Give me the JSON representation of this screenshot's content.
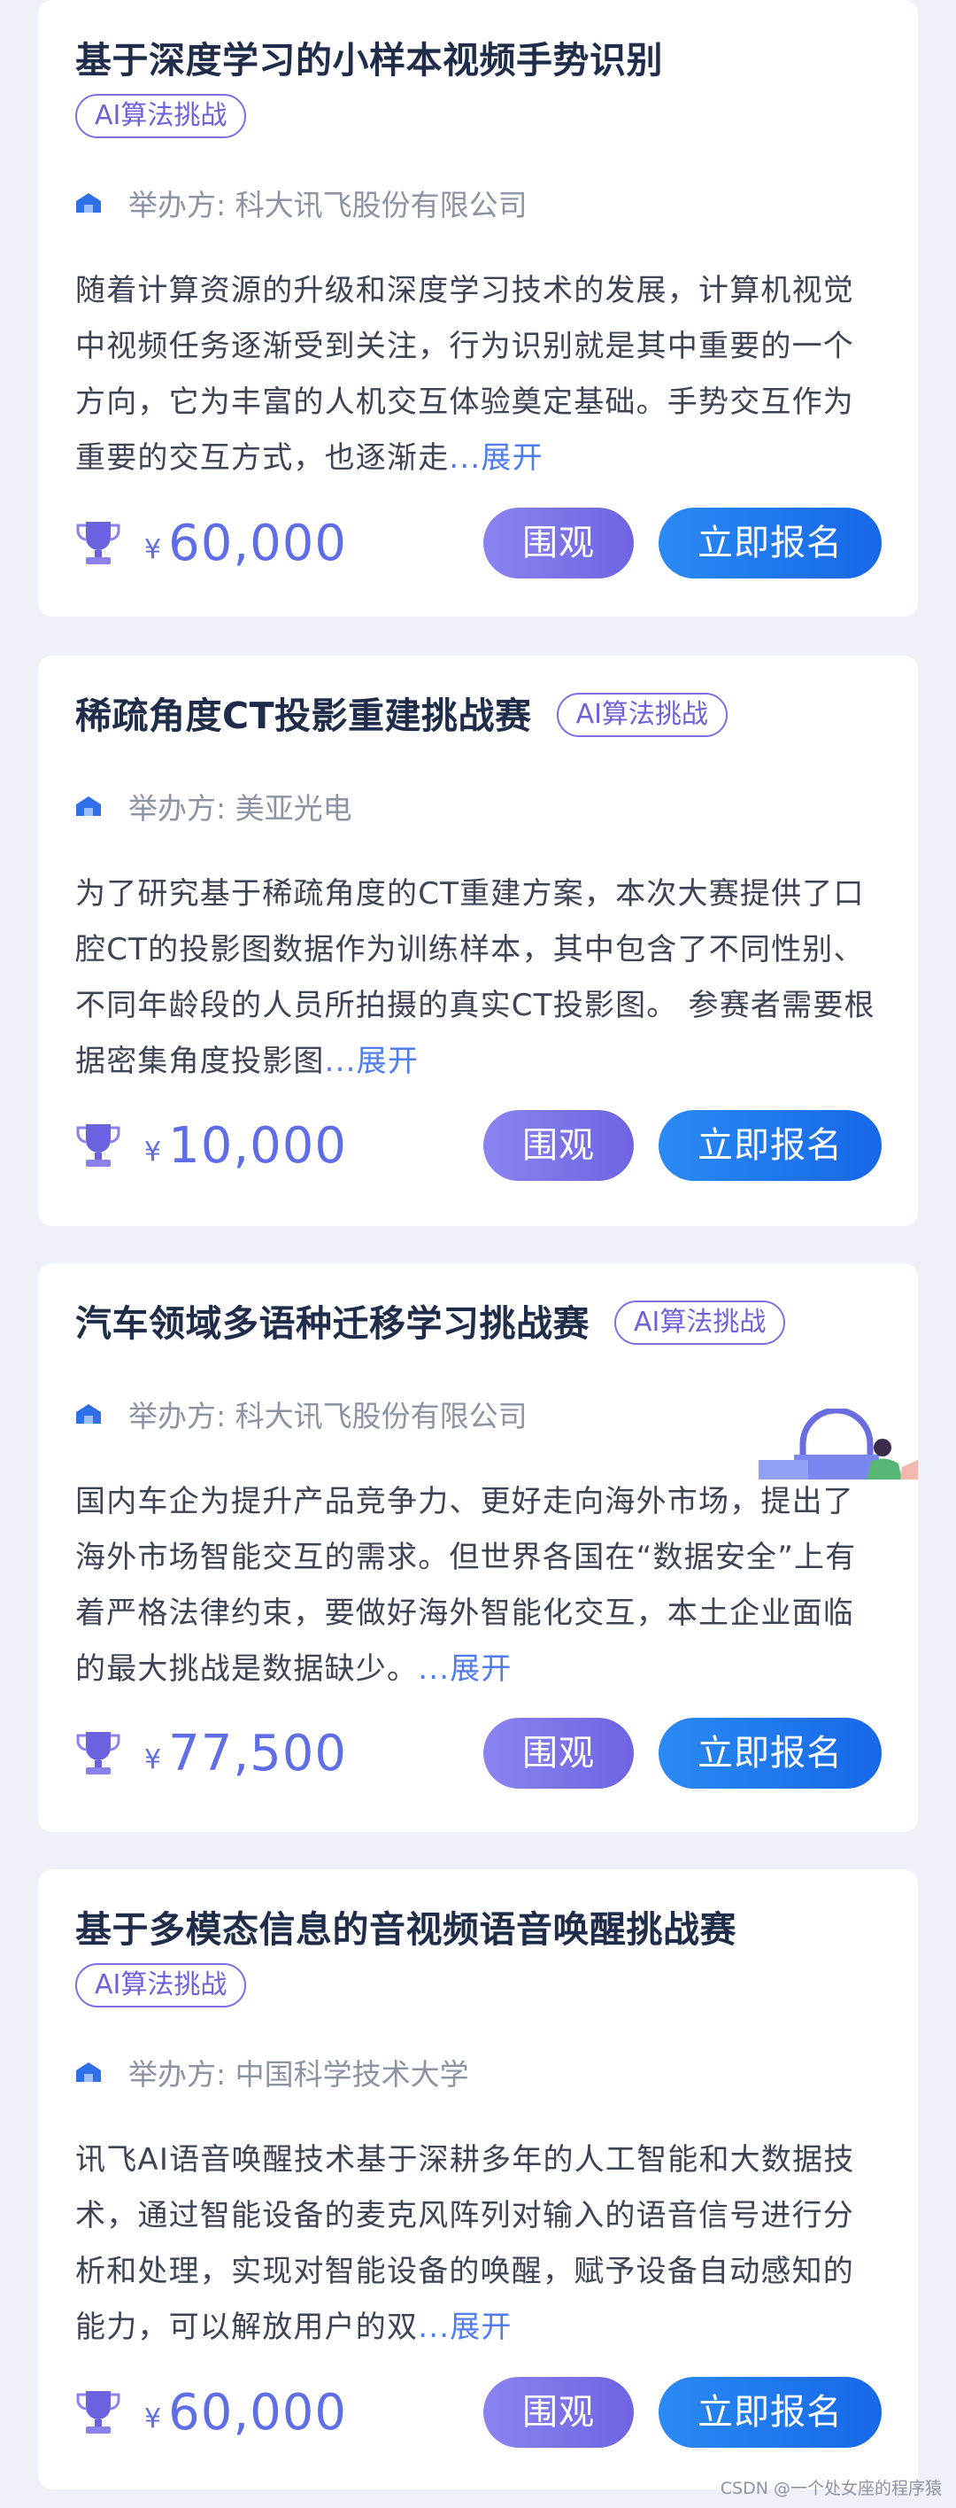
{
  "colors": {
    "background": "#eef1f7",
    "title": "#1f2c4a",
    "accent_purple": "#6e62d9",
    "prize_blue": "#5f6ee6",
    "primary_blue": "#1768e8",
    "more_link": "#4f7cf0"
  },
  "competitions": [
    {
      "title": "基于深度学习的小样本视频手势识别",
      "tag": "AI算法挑战",
      "organizer": "举办方: 科大讯飞股份有限公司",
      "description": "随着计算资源的升级和深度学习技术的发展，计算机视觉中视频任务逐渐受到关注，行为识别就是其中重要的一个方向，它为丰富的人机交互体验奠定基础。手势交互作为重要的交互方式，也逐渐走",
      "more": "...展开",
      "currency": "¥",
      "prize": "60,000",
      "watch_label": "围观",
      "signup_label": "立即报名",
      "icons": [
        "house-icon",
        "trophy-icon"
      ]
    },
    {
      "title": "稀疏角度CT投影重建挑战赛",
      "tag": "AI算法挑战",
      "organizer": "举办方: 美亚光电",
      "description": "为了研究基于稀疏角度的CT重建方案，本次大赛提供了口腔CT的投影图数据作为训练样本，其中包含了不同性别、不同年龄段的人员所拍摄的真实CT投影图。 参赛者需要根据密集角度投影图",
      "more": "...展开",
      "currency": "¥",
      "prize": "10,000",
      "watch_label": "围观",
      "signup_label": "立即报名",
      "icons": [
        "house-icon",
        "trophy-icon"
      ]
    },
    {
      "title": "汽车领域多语种迁移学习挑战赛",
      "tag": "AI算法挑战",
      "organizer": "举办方: 科大讯飞股份有限公司",
      "description": "国内车企为提升产品竞争力、更好走向海外市场，提出了海外市场智能交互的需求。但世界各国在“数据安全”上有着严格法律约束，要做好海外智能化交互，本土企业面临的最大挑战是数据缺少。",
      "more": "...展开",
      "currency": "¥",
      "prize": "77,500",
      "watch_label": "围观",
      "signup_label": "立即报名",
      "icons": [
        "house-icon",
        "trophy-icon"
      ]
    },
    {
      "title": "基于多模态信息的音视频语音唤醒挑战赛",
      "tag": "AI算法挑战",
      "organizer": "举办方: 中国科学技术大学",
      "description": "讯飞AI语音唤醒技术基于深耕多年的人工智能和大数据技术，通过智能设备的麦克风阵列对输入的语音信号进行分析和处理，实现对智能设备的唤醒，赋予设备自动感知的能力，可以解放用户的双",
      "more": "...展开",
      "currency": "¥",
      "prize": "60,000",
      "watch_label": "围观",
      "signup_label": "立即报名",
      "icons": [
        "house-icon",
        "trophy-icon"
      ]
    }
  ],
  "watermark": "CSDN @一个处女座的程序猿"
}
